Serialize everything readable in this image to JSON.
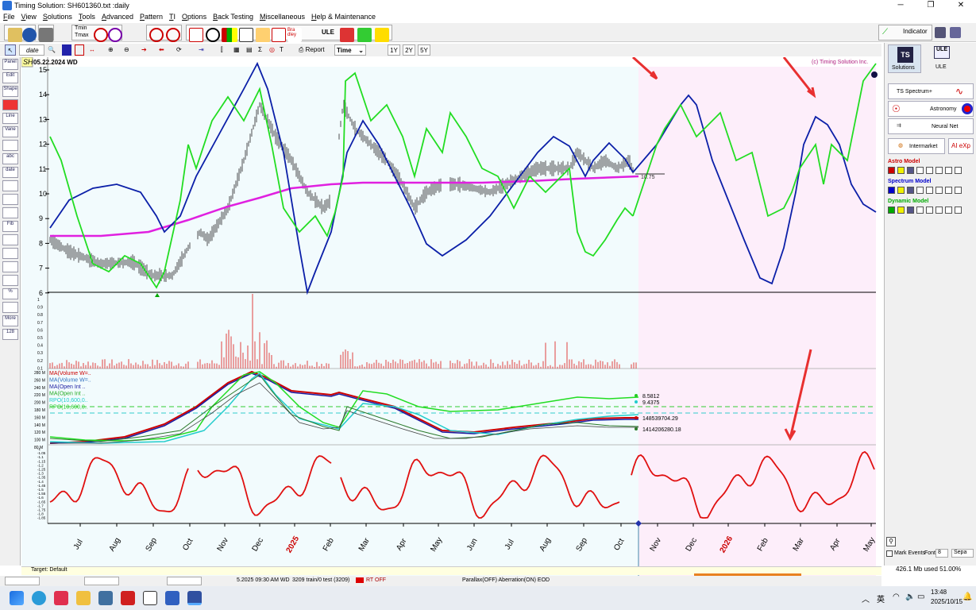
{
  "window": {
    "title": "Timing Solution:  SH601360.txt :daily"
  },
  "menu": [
    "File",
    "View",
    "Solutions",
    "Tools",
    "Advanced",
    "Pattern",
    "TI",
    "Options",
    "Back Testing",
    "Miscellaneous",
    "Help & Maintenance"
  ],
  "toolbar": {
    "date_label": "date",
    "report_label": "Report",
    "time_select": "Time",
    "range_buttons": [
      "1Y",
      "2Y",
      "5Y"
    ],
    "indicator_label": "Indicator",
    "tmin_label": "Tmin",
    "tmax_label": "Tmax",
    "ule_label": "ULE"
  },
  "sidebar_items": [
    "Panel",
    "Edit",
    "Shape",
    "",
    "Line",
    "Vane",
    "",
    "abc",
    "date",
    "",
    "",
    "",
    "Fib",
    "",
    "",
    "",
    "",
    "%",
    "",
    "More",
    "128"
  ],
  "chart": {
    "symbol_badge": "SH",
    "date_header": "05.22.2024 WD",
    "copyright": "(c) Timing Solution Inc.",
    "price_ticks": [
      "15",
      "14",
      "13",
      "12",
      "11",
      "10",
      "9",
      "8",
      "7",
      "6"
    ],
    "x_labels": [
      "Jul",
      "Aug",
      "Sep",
      "Oct",
      "Nov",
      "Dec",
      "2025",
      "Feb",
      "Mar",
      "Apr",
      "May",
      "Jun",
      "Jul",
      "Aug",
      "Sep",
      "Oct",
      "Nov",
      "Dec",
      "2026",
      "Feb",
      "Mar",
      "Apr",
      "May"
    ],
    "price_marker": "10.75",
    "volume_ticks": [
      "1",
      "0.9",
      "0.8",
      "0.7",
      "0.6",
      "0.5",
      "0.4",
      "0.3",
      "0.2",
      "0.1"
    ],
    "ma_legend": [
      "MA(Volume W=..",
      "MA(Volume W=..",
      "MA(Open Int ..",
      "MA(Open Int ..",
      "RPO(10,600,0..",
      "RPO(10,600,0.."
    ],
    "ma_values": [
      "8.5812",
      "9.4375",
      "148539704.29",
      "1414206280.18"
    ],
    "ma_ticks": [
      "280 M",
      "260 M",
      "240 M",
      "220 M",
      "200 M",
      "180 M",
      "160 M",
      "140 M",
      "120 M",
      "100 M",
      "80 M"
    ],
    "osc_ticks": [
      "-1",
      "-1.05",
      "-1.1",
      "-1.15",
      "-1.2",
      "-1.25",
      "-1.3",
      "-1.35",
      "-1.4",
      "-1.45",
      "-1.5",
      "-1.55",
      "-1.6",
      "-1.65",
      "-1.7",
      "-1.75",
      "-1.8",
      "-1.85"
    ],
    "colors": {
      "price": "#000000",
      "green": "#22dd22",
      "blue": "#0b1fa8",
      "magenta": "#e020e0",
      "volume": "#e04040",
      "red": "#e01010",
      "forecast_bg": "#fdeefa",
      "history_bg": "#f2fbfd"
    }
  },
  "right_panel": {
    "solutions_label": "Solutions",
    "ule_label": "ULE",
    "ts_spectrum_label": "TS Spectrum+",
    "astronomy_label": "Astronomy",
    "neural_net_label": "Neural Net",
    "intermarket_label": "Intermarket",
    "ai_exp_label": "AI eXp",
    "models": [
      "Astro Model",
      "Spectrum Model",
      "Dynamic Model"
    ],
    "mark_events_label": "Mark Events",
    "font_label": "Font",
    "font_value": "8",
    "sepa_label": "Sepa",
    "memory_label": "426.1 Mb used 51.00%"
  },
  "status": {
    "target": "Target: Default",
    "date_time": "5.2025  09:30 AM WD",
    "train_info": "3209 train/0 test (3209)",
    "rt_off": "RT OFF",
    "parallax": "Parallax(OFF) Aberration(ON) EOD"
  },
  "taskbar": {
    "time": "13:48",
    "date": "2025/10/15",
    "lang": "英"
  }
}
